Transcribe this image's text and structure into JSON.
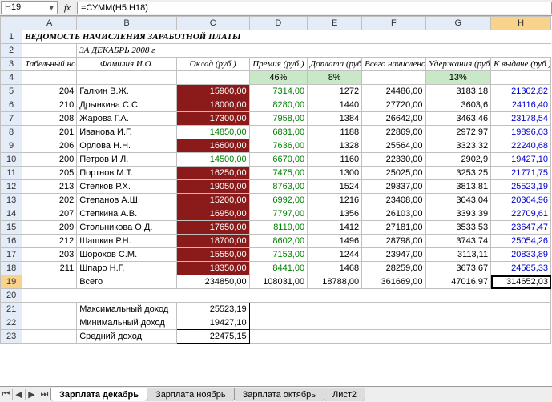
{
  "namebox": "H19",
  "fx_label": "fx",
  "formula": "=СУММ(H5:H18)",
  "title": "ВЕДОМОСТЬ НАЧИСЛЕНИЯ ЗАРАБОТНОЙ ПЛАТЫ",
  "subtitle": "ЗА ДЕКАБРЬ 2008 г",
  "col_letters": [
    "A",
    "B",
    "C",
    "D",
    "E",
    "F",
    "G",
    "H"
  ],
  "row_nums": [
    "1",
    "2",
    "3",
    "4",
    "5",
    "6",
    "7",
    "8",
    "9",
    "10",
    "11",
    "12",
    "13",
    "14",
    "15",
    "16",
    "17",
    "18",
    "19",
    "20",
    "21",
    "22",
    "23"
  ],
  "headers": {
    "tabnum": "Табельный номер",
    "fio": "Фамилия И.О.",
    "oklad": "Оклад (руб.)",
    "prem": "Премия (руб.)",
    "dop": "Доплата (руб.)",
    "vsego": "Всего начислено (руб.)",
    "uder": "Удержания (руб.)",
    "vyd": "К выдаче (руб.)"
  },
  "pct": {
    "prem": "46%",
    "dop": "8%",
    "uder": "13%"
  },
  "rows": [
    {
      "n": "204",
      "f": "Галкин В.Ж.",
      "o": "15900,00",
      "p": "7314,00",
      "d": "1272",
      "v": "24486,00",
      "u": "3183,18",
      "k": "21302,82",
      "red": true
    },
    {
      "n": "210",
      "f": "Дрынкина С.С.",
      "o": "18000,00",
      "p": "8280,00",
      "d": "1440",
      "v": "27720,00",
      "u": "3603,6",
      "k": "24116,40",
      "red": true
    },
    {
      "n": "208",
      "f": "Жарова Г.А.",
      "o": "17300,00",
      "p": "7958,00",
      "d": "1384",
      "v": "26642,00",
      "u": "3463,46",
      "k": "23178,54",
      "red": true
    },
    {
      "n": "201",
      "f": "Иванова И.Г.",
      "o": "14850,00",
      "p": "6831,00",
      "d": "1188",
      "v": "22869,00",
      "u": "2972,97",
      "k": "19896,03",
      "red": false
    },
    {
      "n": "206",
      "f": "Орлова Н.Н.",
      "o": "16600,00",
      "p": "7636,00",
      "d": "1328",
      "v": "25564,00",
      "u": "3323,32",
      "k": "22240,68",
      "red": true
    },
    {
      "n": "200",
      "f": "Петров И.Л.",
      "o": "14500,00",
      "p": "6670,00",
      "d": "1160",
      "v": "22330,00",
      "u": "2902,9",
      "k": "19427,10",
      "red": false
    },
    {
      "n": "205",
      "f": "Портнов М.Т.",
      "o": "16250,00",
      "p": "7475,00",
      "d": "1300",
      "v": "25025,00",
      "u": "3253,25",
      "k": "21771,75",
      "red": true
    },
    {
      "n": "213",
      "f": "Стелков Р.Х.",
      "o": "19050,00",
      "p": "8763,00",
      "d": "1524",
      "v": "29337,00",
      "u": "3813,81",
      "k": "25523,19",
      "red": true
    },
    {
      "n": "202",
      "f": "Степанов А.Ш.",
      "o": "15200,00",
      "p": "6992,00",
      "d": "1216",
      "v": "23408,00",
      "u": "3043,04",
      "k": "20364,96",
      "red": true
    },
    {
      "n": "207",
      "f": "Степкина А.В.",
      "o": "16950,00",
      "p": "7797,00",
      "d": "1356",
      "v": "26103,00",
      "u": "3393,39",
      "k": "22709,61",
      "red": true
    },
    {
      "n": "209",
      "f": "Стольникова О.Д.",
      "o": "17650,00",
      "p": "8119,00",
      "d": "1412",
      "v": "27181,00",
      "u": "3533,53",
      "k": "23647,47",
      "red": true
    },
    {
      "n": "212",
      "f": "Шашкин Р.Н.",
      "o": "18700,00",
      "p": "8602,00",
      "d": "1496",
      "v": "28798,00",
      "u": "3743,74",
      "k": "25054,26",
      "red": true
    },
    {
      "n": "203",
      "f": "Шорохов С.М.",
      "o": "15550,00",
      "p": "7153,00",
      "d": "1244",
      "v": "23947,00",
      "u": "3113,11",
      "k": "20833,89",
      "red": true
    },
    {
      "n": "211",
      "f": "Шпаро Н.Г.",
      "o": "18350,00",
      "p": "8441,00",
      "d": "1468",
      "v": "28259,00",
      "u": "3673,67",
      "k": "24585,33",
      "red": true
    }
  ],
  "totals": {
    "label": "Всего",
    "o": "234850,00",
    "p": "108031,00",
    "d": "18788,00",
    "v": "361669,00",
    "u": "47016,97",
    "k": "314652,03"
  },
  "stats": {
    "max_l": "Максимальный доход",
    "max_v": "25523,19",
    "min_l": "Минимальный доход",
    "min_v": "19427,10",
    "avg_l": "Средний доход",
    "avg_v": "22475,15"
  },
  "tabs": [
    "Зарплата декабрь",
    "Зарплата ноябрь",
    "Зарплата октябрь",
    "Лист2"
  ]
}
